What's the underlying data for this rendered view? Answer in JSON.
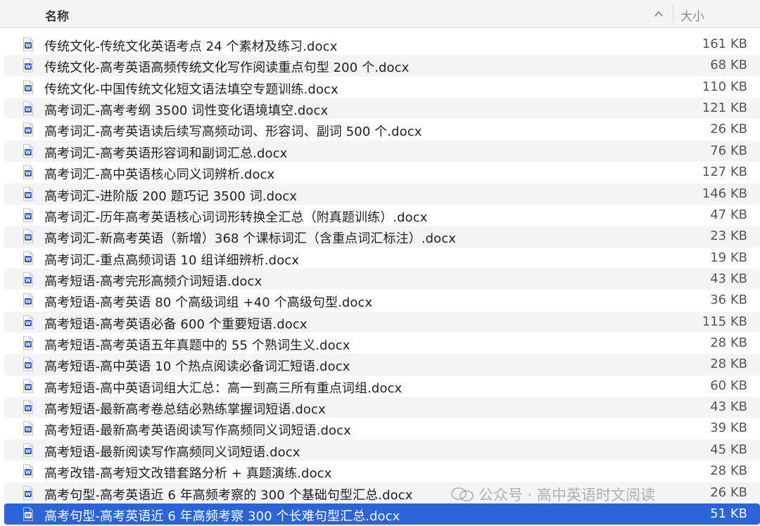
{
  "header": {
    "name_label": "名称",
    "size_label": "大小",
    "sort_icon": "chevron-up-icon"
  },
  "files": [
    {
      "name": "传统文化-传统文化英语考点 24 个素材及练习.docx",
      "size": "161 KB"
    },
    {
      "name": "传统文化-高考英语高频传统文化写作阅读重点句型 200 个.docx",
      "size": "68 KB"
    },
    {
      "name": "传统文化-中国传统文化短文语法填空专题训练.docx",
      "size": "110 KB"
    },
    {
      "name": "高考词汇-高考考纲 3500 词性变化语境填空.docx",
      "size": "121 KB"
    },
    {
      "name": "高考词汇-高考英语读后续写高频动词、形容词、副词 500 个.docx",
      "size": "26 KB"
    },
    {
      "name": "高考词汇-高考英语形容词和副词汇总.docx",
      "size": "76 KB"
    },
    {
      "name": "高考词汇-高中英语核心同义词辨析.docx",
      "size": "127 KB"
    },
    {
      "name": "高考词汇-进阶版 200 题巧记 3500 词.docx",
      "size": "146 KB"
    },
    {
      "name": "高考词汇-历年高考英语核心词词形转换全汇总（附真题训练）.docx",
      "size": "47 KB"
    },
    {
      "name": "高考词汇-新高考英语（新增）368 个课标词汇（含重点词汇标注）.docx",
      "size": "23 KB"
    },
    {
      "name": "高考词汇-重点高频词语 10 组详细辨析.docx",
      "size": "19 KB"
    },
    {
      "name": "高考短语-高考完形高频介词短语.docx",
      "size": "43 KB"
    },
    {
      "name": "高考短语-高考英语 80 个高级词组 +40 个高级句型.docx",
      "size": "36 KB"
    },
    {
      "name": "高考短语-高考英语必备 600 个重要短语.docx",
      "size": "115 KB"
    },
    {
      "name": "高考短语-高考英语五年真题中的 55 个熟词生义.docx",
      "size": "28 KB"
    },
    {
      "name": "高考短语-高中英语 10 个热点阅读必备词汇短语.docx",
      "size": "28 KB"
    },
    {
      "name": "高考短语-高中英语词组大汇总：高一到高三所有重点词组.docx",
      "size": "60 KB"
    },
    {
      "name": "高考短语-最新高考卷总结必熟练掌握词短语.docx",
      "size": "43 KB"
    },
    {
      "name": "高考短语-最新高考英语阅读写作高频同义词短语.docx",
      "size": "39 KB"
    },
    {
      "name": "高考短语-最新阅读写作高频同义词短语.docx",
      "size": "45 KB"
    },
    {
      "name": "高考改错-高考短文改错套路分析 + 真题演练.docx",
      "size": "28 KB"
    },
    {
      "name": "高考句型-高考英语近 6 年高频考察的 300 个基础句型汇总.docx",
      "size": "26 KB"
    },
    {
      "name": "高考句型-高考英语近 6 年高频考察 300 个长难句型汇总.docx",
      "size": "51 KB",
      "selected": true
    }
  ],
  "file_icon": "word-document-icon",
  "watermark": {
    "text": "公众号 · 高中英语时文阅读",
    "icon": "wechat-icon"
  },
  "colors": {
    "selection": "#2b63d9",
    "stripe": "#f4f4f5",
    "word_blue": "#2f5fbf"
  }
}
